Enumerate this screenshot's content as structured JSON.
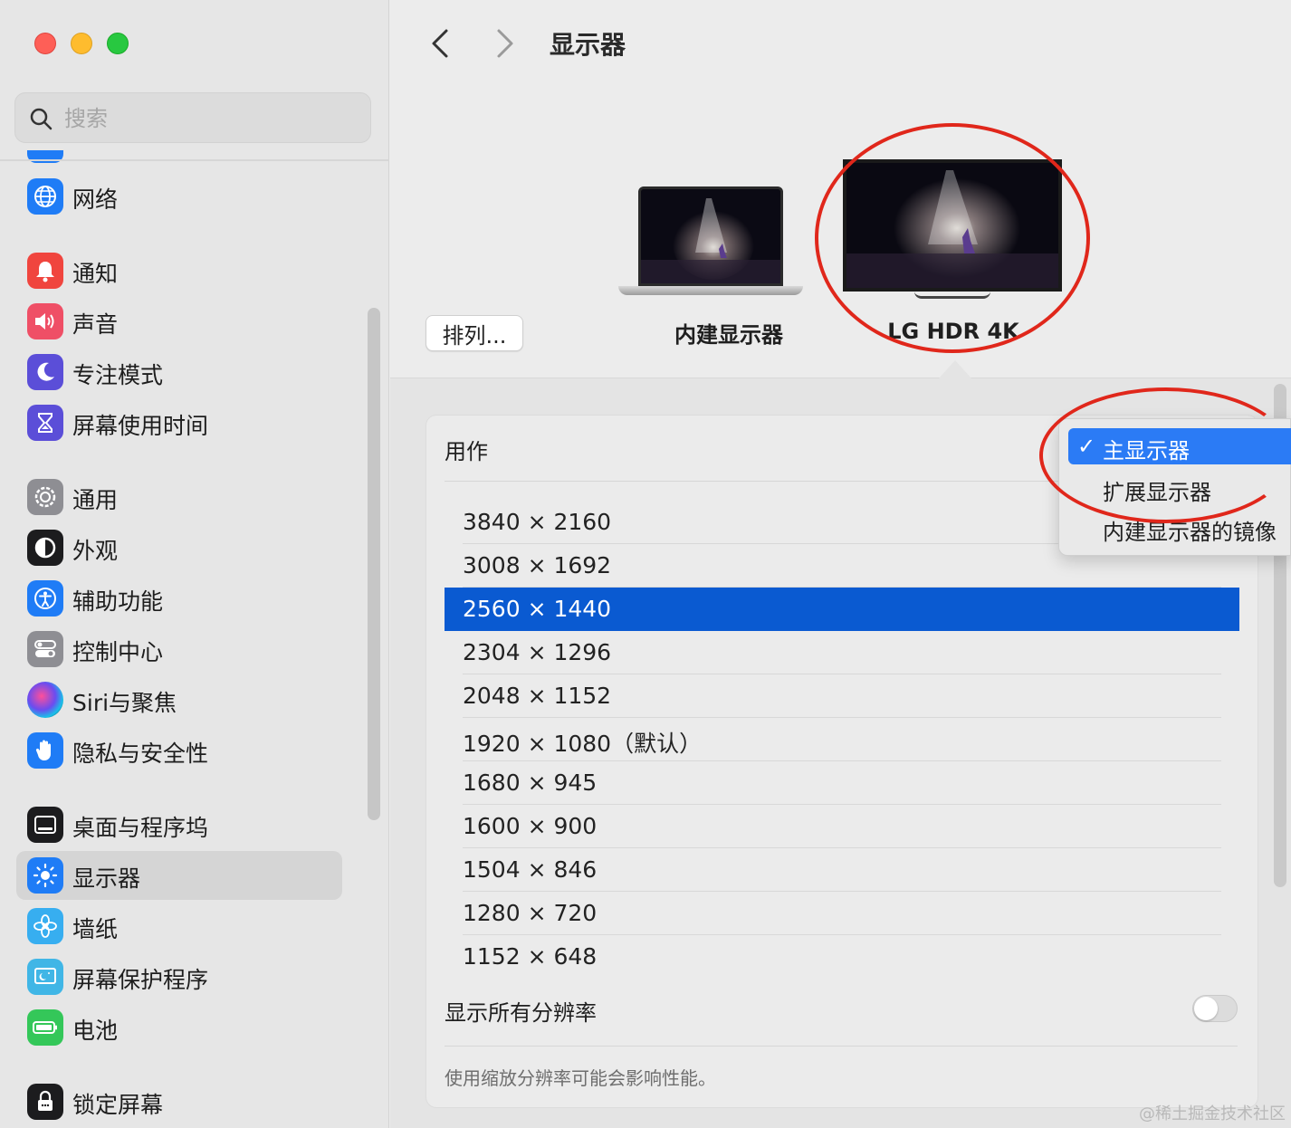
{
  "window": {
    "title": "显示器"
  },
  "search": {
    "placeholder": "搜索"
  },
  "sidebar": {
    "items": [
      {
        "label": "网络",
        "icon": "globe-icon",
        "color": "#1f7cf6"
      },
      {
        "label": "通知",
        "icon": "bell-icon",
        "color": "#f0453e"
      },
      {
        "label": "声音",
        "icon": "speaker-icon",
        "color": "#ef4f66"
      },
      {
        "label": "专注模式",
        "icon": "moon-icon",
        "color": "#5b4ed8"
      },
      {
        "label": "屏幕使用时间",
        "icon": "hourglass-icon",
        "color": "#5b4ed8"
      },
      {
        "label": "通用",
        "icon": "gear-icon",
        "color": "#8e8e93"
      },
      {
        "label": "外观",
        "icon": "appearance-icon",
        "color": "#1c1c1e"
      },
      {
        "label": "辅助功能",
        "icon": "accessibility-icon",
        "color": "#1f7cf6"
      },
      {
        "label": "控制中心",
        "icon": "toggles-icon",
        "color": "#8e8e93"
      },
      {
        "label": "Siri与聚焦",
        "icon": "siri-icon",
        "color": "#3a3a6a"
      },
      {
        "label": "隐私与安全性",
        "icon": "hand-icon",
        "color": "#1f7cf6"
      },
      {
        "label": "桌面与程序坞",
        "icon": "dock-icon",
        "color": "#1c1c1e"
      },
      {
        "label": "显示器",
        "icon": "sun-icon",
        "color": "#1f7cf6",
        "selected": true
      },
      {
        "label": "墙纸",
        "icon": "flower-icon",
        "color": "#37aef0"
      },
      {
        "label": "屏幕保护程序",
        "icon": "screensaver-icon",
        "color": "#40b6e6"
      },
      {
        "label": "电池",
        "icon": "battery-icon",
        "color": "#34c759"
      },
      {
        "label": "锁定屏幕",
        "icon": "lock-icon",
        "color": "#1c1c1e"
      }
    ]
  },
  "displays": {
    "arrange_label": "排列...",
    "builtin_label": "内建显示器",
    "external_label": "LG HDR 4K"
  },
  "settings": {
    "use_as_label": "用作",
    "resolutions": [
      "3840 × 2160",
      "3008 × 1692",
      "2560 × 1440",
      "2304 × 1296",
      "2048 × 1152",
      "1920 × 1080（默认）",
      "1680 × 945",
      "1600 × 900",
      "1504 × 846",
      "1280 × 720",
      "1152 × 648"
    ],
    "selected_resolution_index": 2,
    "show_all_label": "显示所有分辨率",
    "show_all_enabled": false,
    "note": "使用缩放分辨率可能会影响性能。"
  },
  "use_as_menu": {
    "options": [
      "主显示器",
      "扩展显示器",
      "内建显示器的镜像"
    ],
    "checked_index": 0,
    "check_mark": "✓"
  },
  "watermark": "@稀土掘金技术社区",
  "colors": {
    "accent": "#0a5ad1",
    "annotation": "#e0271b"
  }
}
